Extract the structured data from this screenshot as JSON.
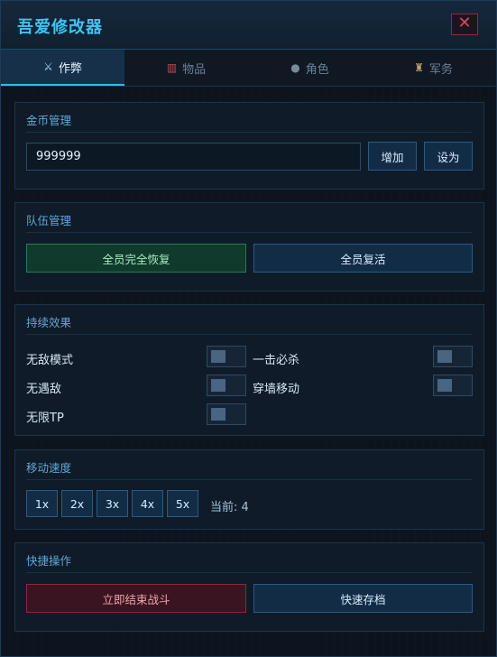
{
  "window": {
    "title": "吾爱修改器",
    "close_glyph": "✕"
  },
  "tabs": [
    {
      "icon": "⚔",
      "label": "作弊",
      "active": true
    },
    {
      "icon": "▥",
      "label": "物品",
      "active": false
    },
    {
      "icon": "●",
      "label": "角色",
      "active": false
    },
    {
      "icon": "♜",
      "label": "军务",
      "active": false
    }
  ],
  "gold": {
    "title": "金币管理",
    "value": "999999",
    "add_label": "增加",
    "set_label": "设为"
  },
  "party": {
    "title": "队伍管理",
    "restore_label": "全员完全恢复",
    "revive_label": "全员复活"
  },
  "effects": {
    "title": "持续效果",
    "items": [
      {
        "label": "无敌模式",
        "enabled": false
      },
      {
        "label": "一击必杀",
        "enabled": false
      },
      {
        "label": "无遇敌",
        "enabled": false
      },
      {
        "label": "穿墙移动",
        "enabled": false
      },
      {
        "label": "无限TP",
        "enabled": false
      }
    ]
  },
  "speed": {
    "title": "移动速度",
    "options": [
      "1x",
      "2x",
      "3x",
      "4x",
      "5x"
    ],
    "current_text": "当前: 4"
  },
  "quick": {
    "title": "快捷操作",
    "end_battle_label": "立即结束战斗",
    "quick_save_label": "快速存档"
  },
  "colors": {
    "accent": "#35b9f0",
    "green_button": "#0f3a2c",
    "red_button": "#3a1420"
  }
}
